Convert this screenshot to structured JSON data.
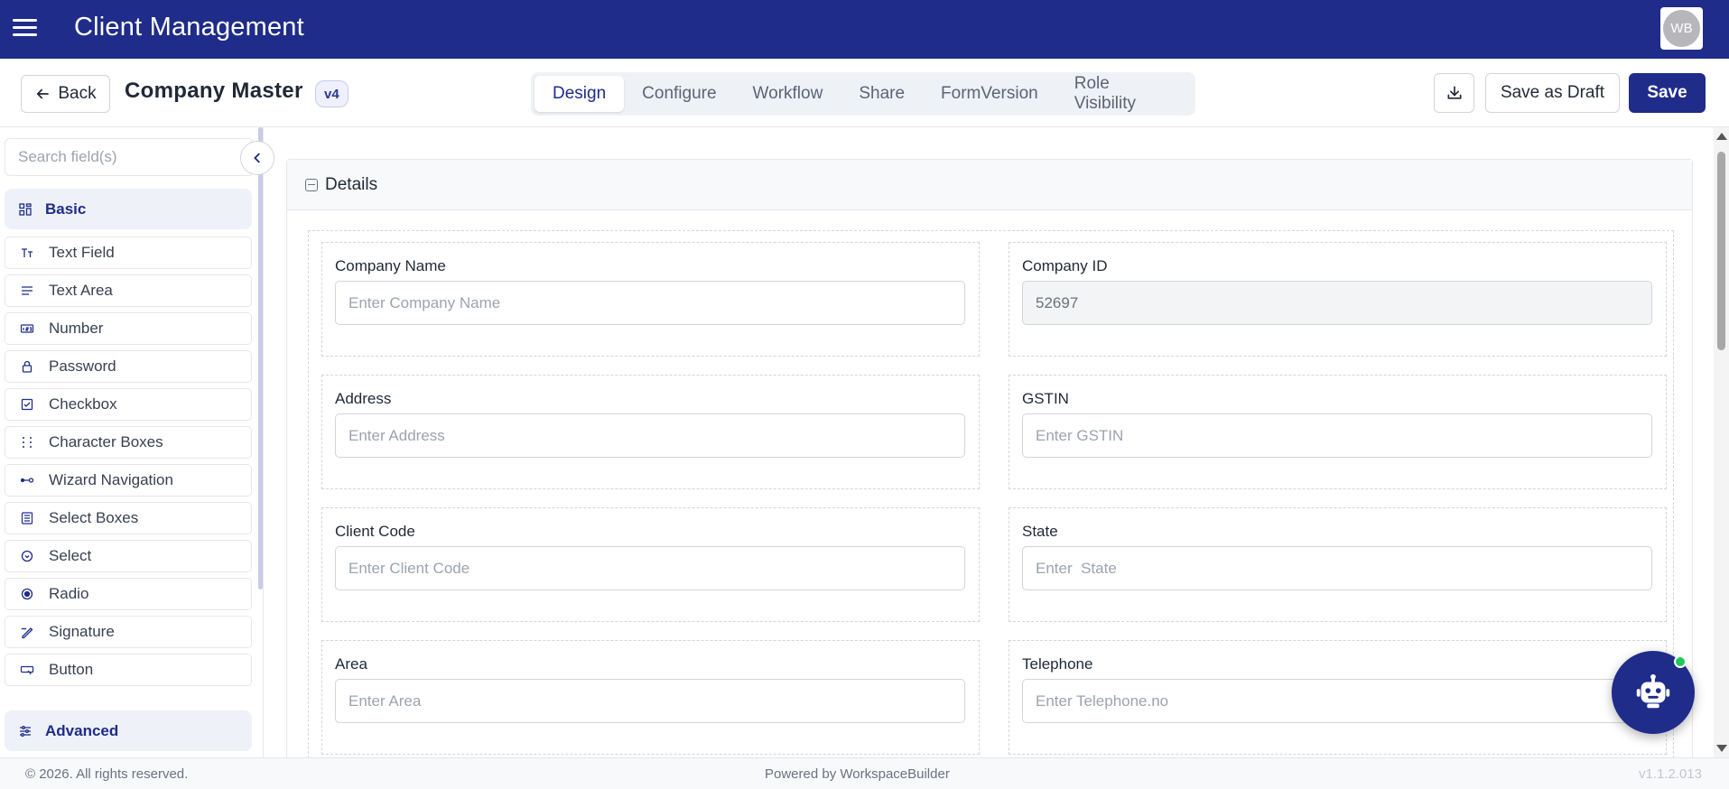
{
  "app": {
    "title": "Client Management",
    "avatar_initials": "WB",
    "brand_color": "#1f2c8a"
  },
  "toolbar": {
    "back_label": "Back",
    "form_title": "Company Master",
    "version": "v4",
    "tabs": [
      {
        "label": "Design",
        "active": true
      },
      {
        "label": "Configure",
        "active": false
      },
      {
        "label": "Workflow",
        "active": false
      },
      {
        "label": "Share",
        "active": false
      },
      {
        "label": "FormVersion",
        "active": false
      },
      {
        "label": "Role Visibility",
        "active": false
      }
    ],
    "download_icon": "download-icon",
    "save_draft_label": "Save as Draft",
    "save_label": "Save"
  },
  "sidebar": {
    "search_placeholder": "Search field(s)",
    "basic_section": "Basic",
    "advanced_section": "Advanced",
    "items": [
      {
        "label": "Text Field",
        "icon": "text-field-icon"
      },
      {
        "label": "Text Area",
        "icon": "text-area-icon"
      },
      {
        "label": "Number",
        "icon": "number-icon"
      },
      {
        "label": "Password",
        "icon": "lock-icon"
      },
      {
        "label": "Checkbox",
        "icon": "checkbox-icon"
      },
      {
        "label": "Character Boxes",
        "icon": "dots-grid-icon"
      },
      {
        "label": "Wizard Navigation",
        "icon": "wizard-icon"
      },
      {
        "label": "Select Boxes",
        "icon": "list-box-icon"
      },
      {
        "label": "Select",
        "icon": "select-icon"
      },
      {
        "label": "Radio",
        "icon": "radio-icon"
      },
      {
        "label": "Signature",
        "icon": "signature-icon"
      },
      {
        "label": "Button",
        "icon": "button-icon"
      }
    ]
  },
  "main": {
    "panel_title": "Details",
    "fields": [
      {
        "label": "Company Name",
        "placeholder": "Enter Company Name",
        "value": ""
      },
      {
        "label": "Company ID",
        "placeholder": "",
        "value": "52697"
      },
      {
        "label": "Address",
        "placeholder": "Enter Address",
        "value": ""
      },
      {
        "label": "GSTIN",
        "placeholder": "Enter GSTIN",
        "value": ""
      },
      {
        "label": "Client Code",
        "placeholder": "Enter Client Code",
        "value": ""
      },
      {
        "label": "State",
        "placeholder": "Enter  State",
        "value": ""
      },
      {
        "label": "Area",
        "placeholder": "Enter Area",
        "value": ""
      },
      {
        "label": "Telephone",
        "placeholder": "Enter Telephone.no",
        "value": ""
      }
    ]
  },
  "footer": {
    "copyright": "© 2026. All rights reserved.",
    "powered_by": "Powered by WorkspaceBuilder",
    "version": "v1.1.2.013"
  }
}
